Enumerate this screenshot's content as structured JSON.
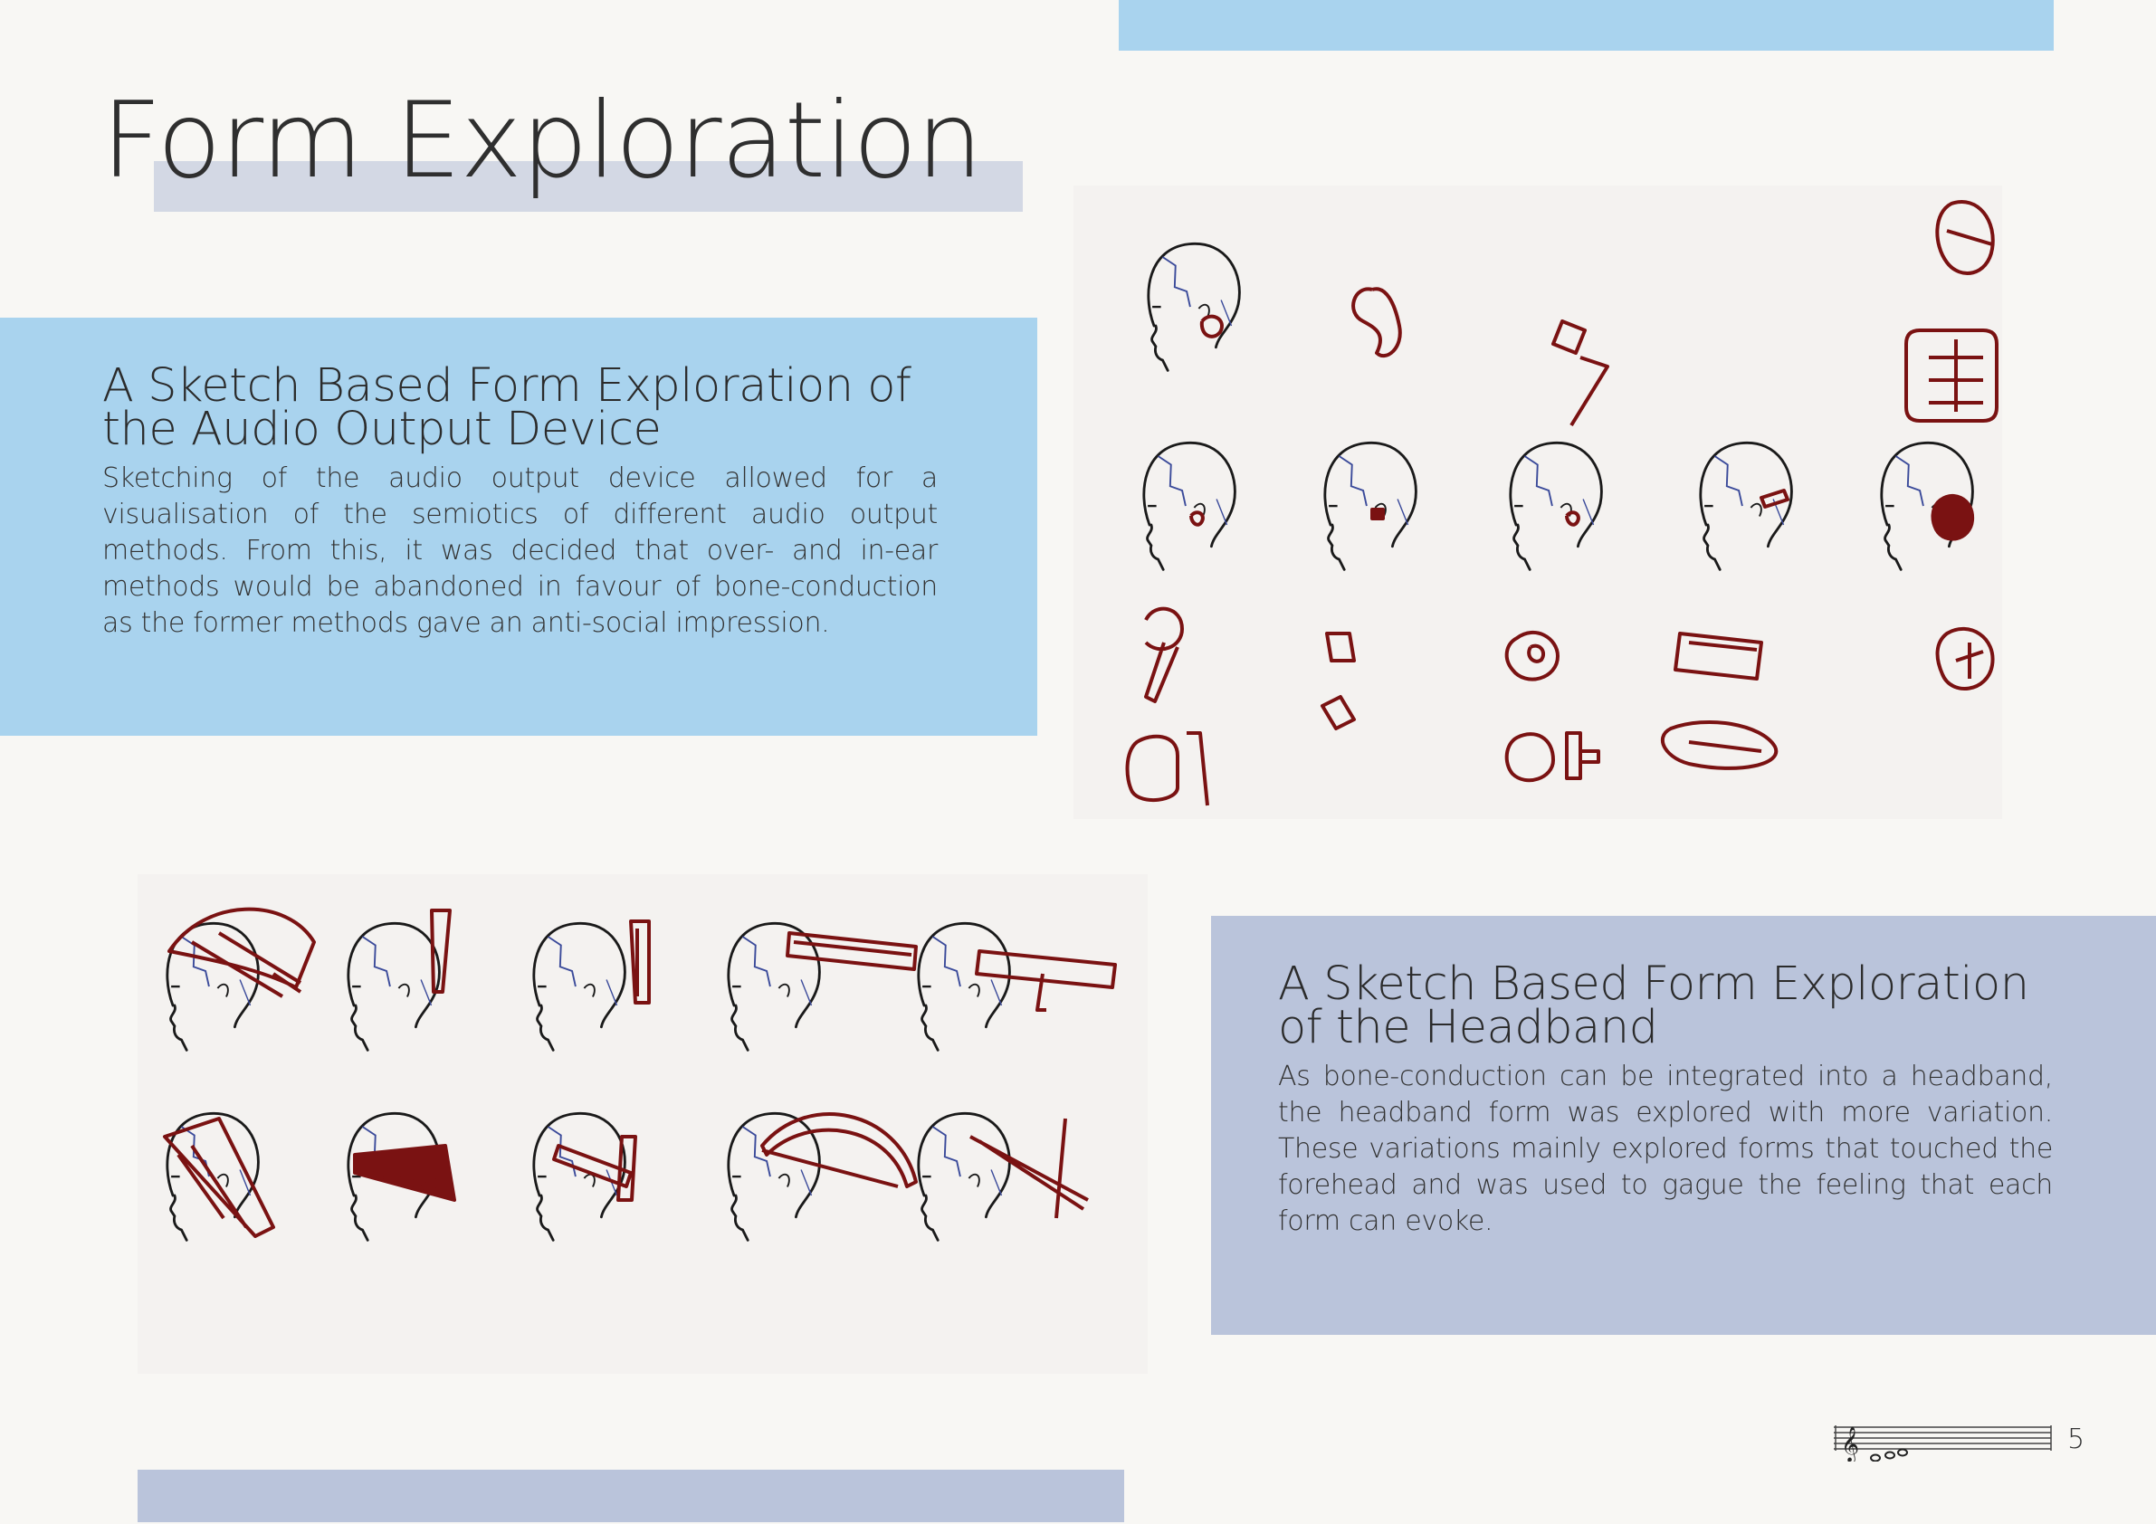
{
  "page": {
    "title": "Form Exploration",
    "page_number": "5"
  },
  "sections": [
    {
      "heading": "A Sketch Based Form Exploration of the Audio Output Device",
      "body": "Sketching of the audio output device allowed for a visualisation of the semiotics of different audio output methods. From this, it was decided that over- and in-ear methods would be abandoned in favour of bone-conduction as the former methods gave an anti-social impression."
    },
    {
      "heading": "A Sketch Based Form Exploration of the Headband",
      "body": "As bone-conduction can be integrated into a headband, the headband form was explored with more variation. These variations mainly explored forms that touched the forehead and was used to gague the feeling that each form can evoke."
    }
  ],
  "colors": {
    "page_background": "#f8f7f4",
    "light_blue": "#a9d3ee",
    "lavender": "#bac4db",
    "title_underline": "#d3d8e4",
    "sketch_line": "#1a1a1a",
    "sketch_device": "#7a1212",
    "sketch_vein": "#3a4a9a"
  },
  "icons": {
    "footer_icon": "music-staff-icon"
  }
}
